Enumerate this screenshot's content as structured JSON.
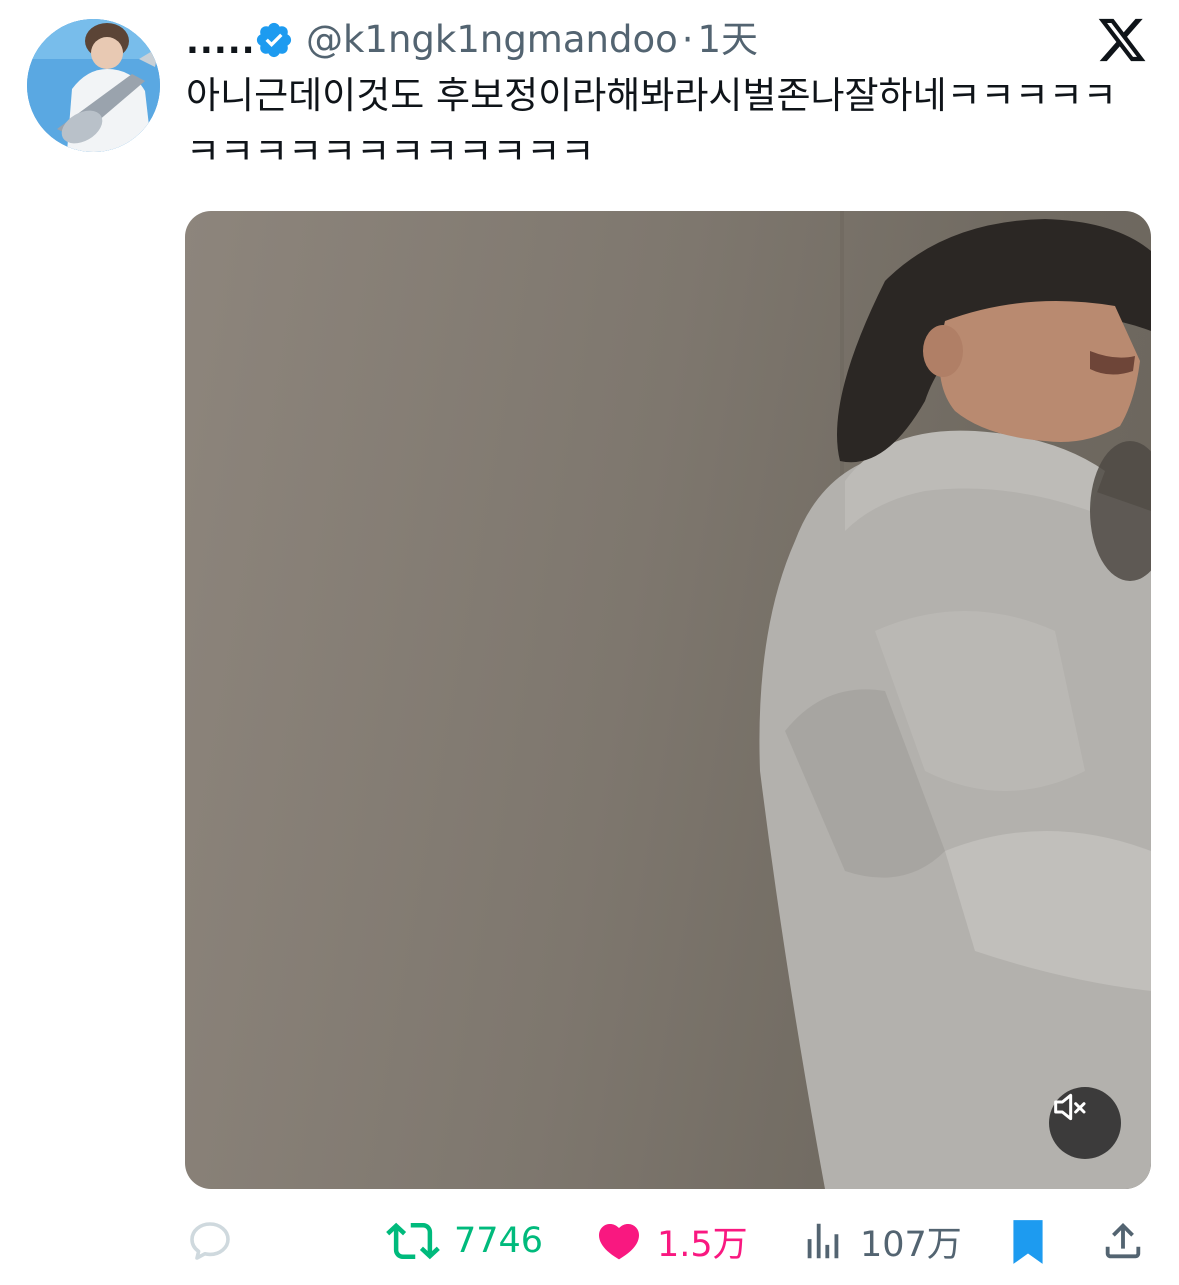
{
  "author": {
    "display_name": ".....",
    "handle": "@k1ngk1ngmandoo",
    "separator": "·",
    "time": "1天",
    "verified": true
  },
  "tweet": {
    "text": "아니근데이것도 후보정이라해봐라시벌존나잘하네ㅋㅋㅋㅋㅋㅋㅋㅋㅋㅋㅋㅋㅋㅋㅋㅋㅋ"
  },
  "media": {
    "type": "video",
    "muted": true
  },
  "actions": {
    "reply": {
      "icon": "reply-icon",
      "count": ""
    },
    "retweet": {
      "icon": "retweet-icon",
      "count": "7746",
      "color": "#00ba7c",
      "active": true
    },
    "like": {
      "icon": "heart-icon",
      "count": "1.5万",
      "color": "#f91880",
      "active": true
    },
    "views": {
      "icon": "analytics-icon",
      "count": "107万",
      "color": "#536471"
    },
    "bookmark": {
      "icon": "bookmark-icon",
      "color": "#1d9bf0",
      "active": true
    },
    "share": {
      "icon": "share-icon"
    }
  },
  "colors": {
    "verified": "#1d9bf0",
    "text": "#0f1419",
    "secondary": "#536471"
  }
}
